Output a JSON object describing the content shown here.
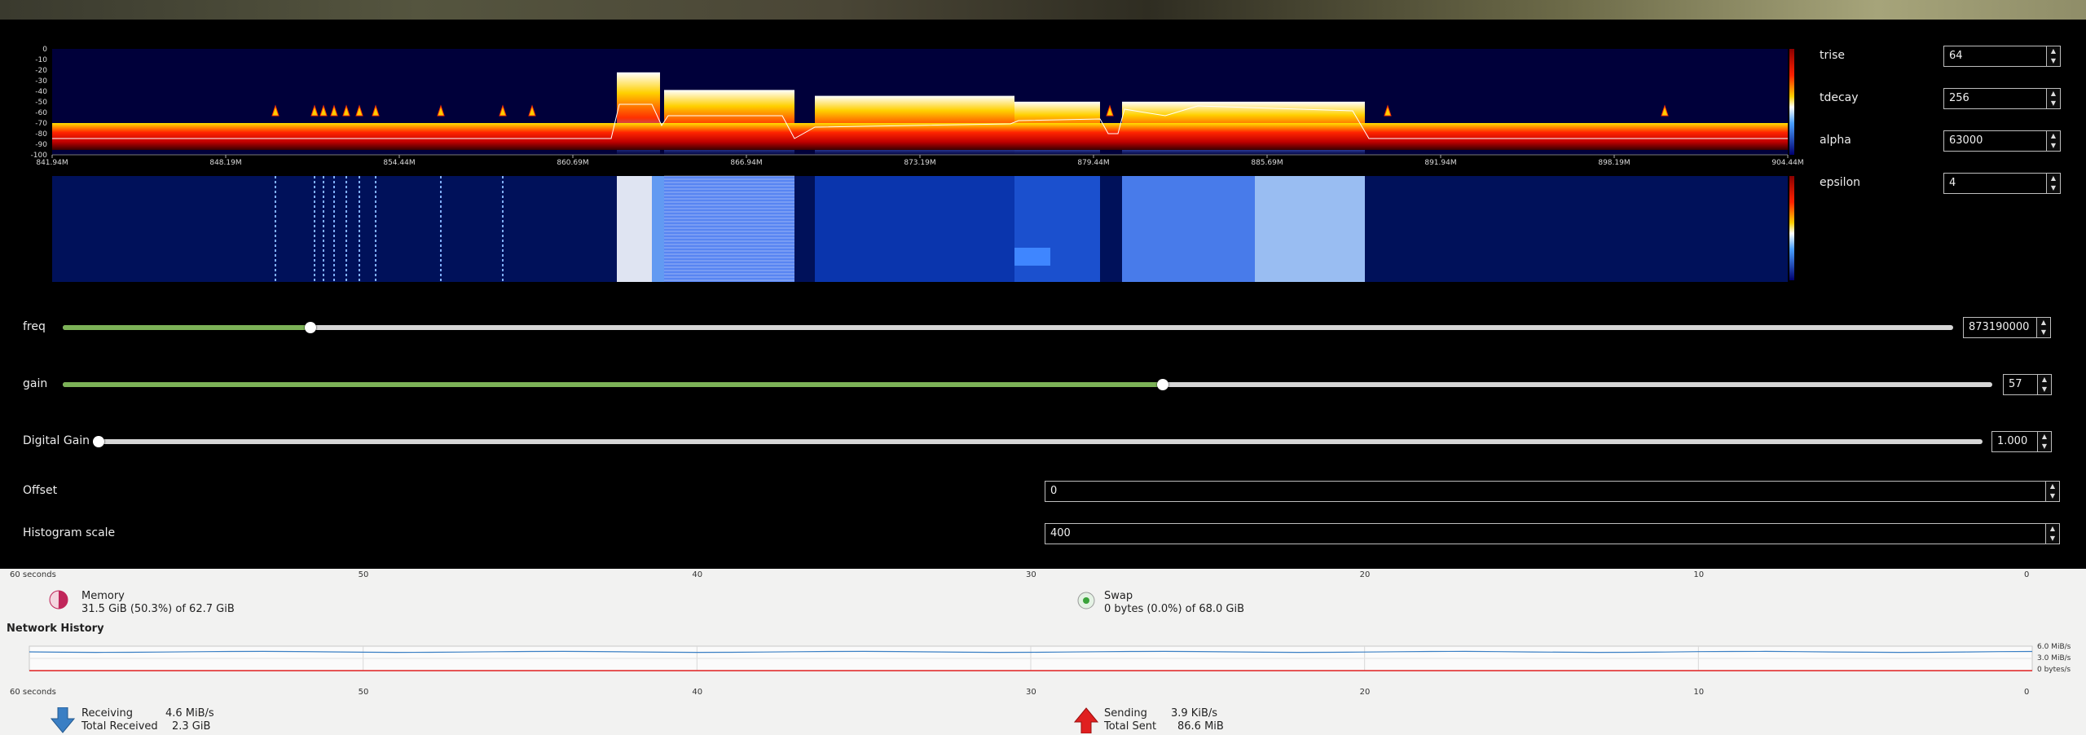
{
  "colors": {
    "accent_green": "#7cb257",
    "spectrum_bg": "#00003a",
    "app_bg": "#000000",
    "monitor_bg": "#f2f2f1",
    "send_red": "#e02020",
    "recv_blue": "#3a7fc4",
    "memory_pink": "#c0265a",
    "swap_green": "#3aa33a"
  },
  "spectrum": {
    "y_ticks": [
      "0",
      "-10",
      "-20",
      "-30",
      "-40",
      "-50",
      "-60",
      "-70",
      "-80",
      "-90",
      "-100"
    ],
    "x_ticks": [
      "841.94M",
      "848.19M",
      "854.44M",
      "860.69M",
      "866.94M",
      "873.19M",
      "879.44M",
      "885.69M",
      "891.94M",
      "898.19M",
      "904.44M"
    ]
  },
  "params": [
    {
      "label": "trise",
      "value": "64"
    },
    {
      "label": "tdecay",
      "value": "256"
    },
    {
      "label": "alpha",
      "value": "63000"
    },
    {
      "label": "epsilon",
      "value": "4"
    }
  ],
  "controls": {
    "freq": {
      "label": "freq",
      "value": "873190000",
      "level": 0.131
    },
    "gain": {
      "label": "gain",
      "value": "57",
      "level": 0.57
    },
    "digital_gain": {
      "label": "Digital Gain",
      "value": "1.000",
      "level": 0.0
    },
    "offset": {
      "label": "Offset",
      "value": "0"
    },
    "histogram_scale": {
      "label": "Histogram scale",
      "value": "400"
    }
  },
  "sysmon": {
    "time_ticks": [
      "60 seconds",
      "50",
      "40",
      "30",
      "20",
      "10",
      "0"
    ],
    "memory": {
      "title": "Memory",
      "detail": "31.5 GiB (50.3%) of 62.7 GiB",
      "fraction": 0.503
    },
    "swap": {
      "title": "Swap",
      "detail": "0 bytes (0.0%) of 68.0 GiB",
      "fraction": 0.0
    },
    "network_title": "Network History",
    "net_y_ticks": [
      "6.0 MiB/s",
      "3.0 MiB/s",
      "0 bytes/s"
    ],
    "receiving": {
      "label": "Receiving",
      "rate": "4.6 MiB/s",
      "total_label": "Total Received",
      "total": "2.3 GiB"
    },
    "sending": {
      "label": "Sending",
      "rate": "3.9 KiB/s",
      "total_label": "Total Sent",
      "total": "86.6 MiB"
    }
  }
}
